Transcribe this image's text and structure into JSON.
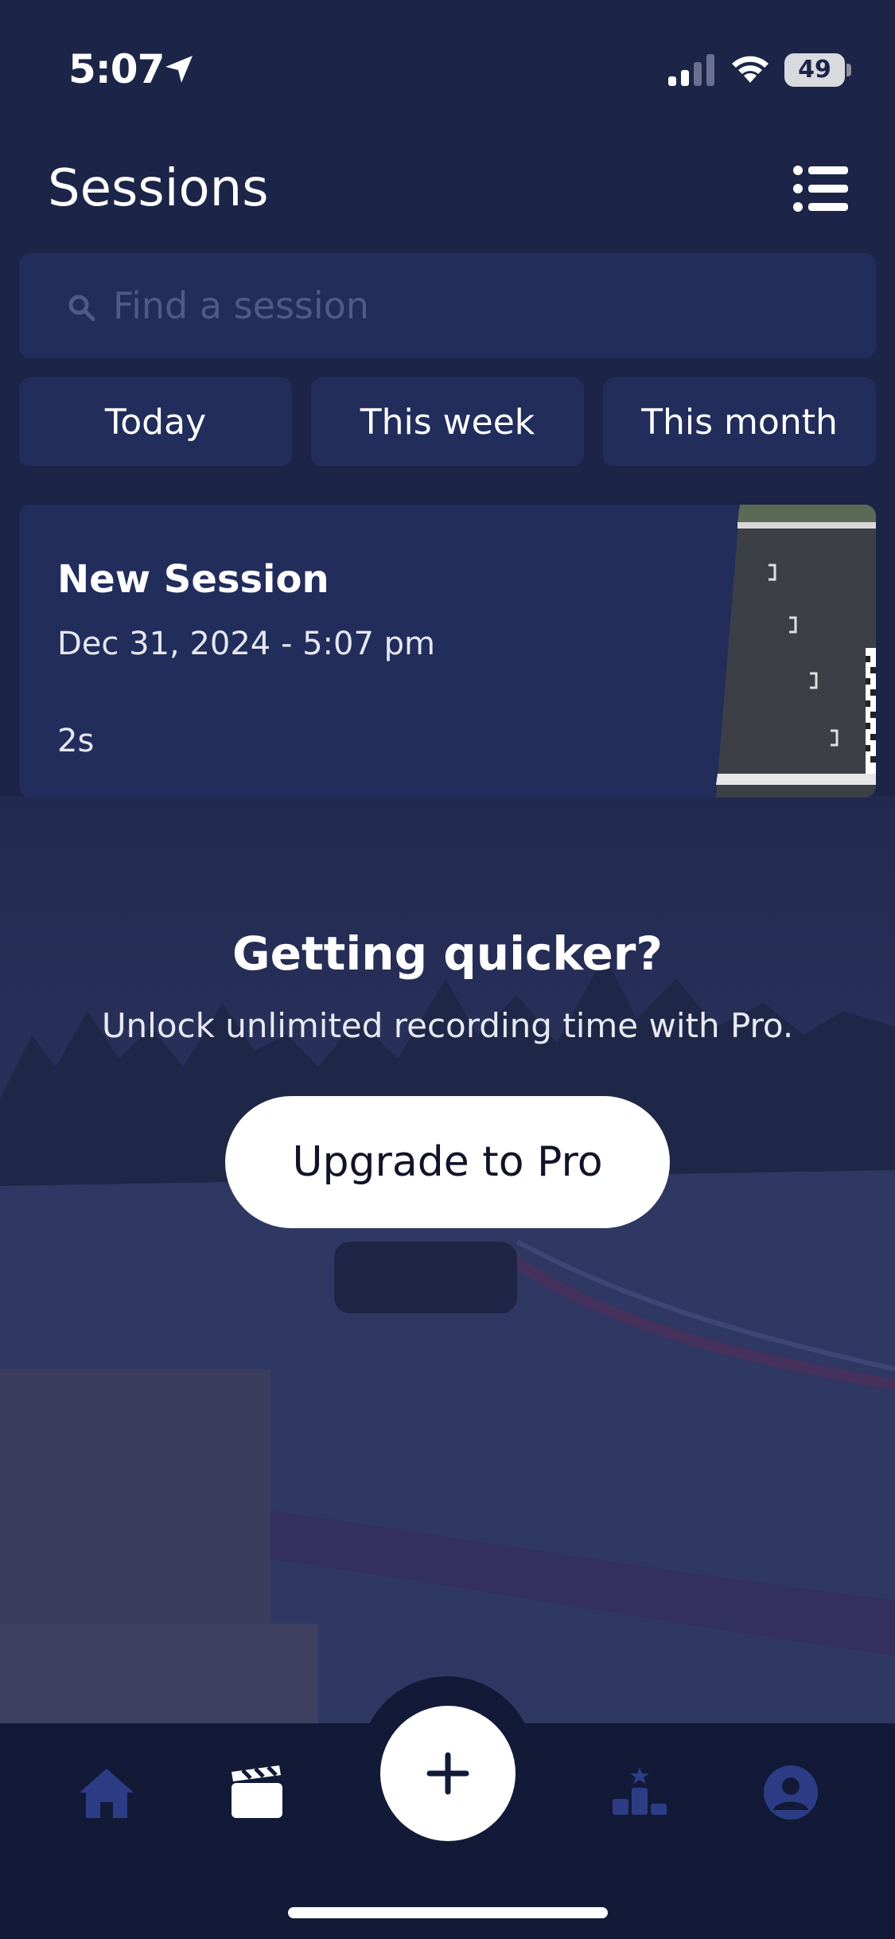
{
  "status_bar": {
    "time": "5:07",
    "battery": "49"
  },
  "header": {
    "title": "Sessions",
    "menu_icon": "list-icon"
  },
  "search": {
    "placeholder": "Find a session",
    "value": ""
  },
  "filters": [
    {
      "label": "Today"
    },
    {
      "label": "This week"
    },
    {
      "label": "This month"
    }
  ],
  "sessions": [
    {
      "title": "New Session",
      "date": "Dec 31, 2024 - 5:07 pm",
      "duration": "2s"
    }
  ],
  "promo": {
    "title": "Getting quicker?",
    "subtitle": "Unlock unlimited recording time with Pro.",
    "button_label": "Upgrade to Pro"
  },
  "tab_bar": {
    "items": [
      {
        "icon": "home-icon",
        "active": false
      },
      {
        "icon": "clapperboard-icon",
        "active": true
      },
      {
        "icon": "plus-icon",
        "active": false
      },
      {
        "icon": "podium-icon",
        "active": false
      },
      {
        "icon": "profile-icon",
        "active": false
      }
    ]
  },
  "colors": {
    "background": "#1c2447",
    "card": "#222d5c",
    "tab_bar": "#121a38",
    "inactive_icon": "#2c3d86",
    "active_icon": "#ffffff"
  }
}
